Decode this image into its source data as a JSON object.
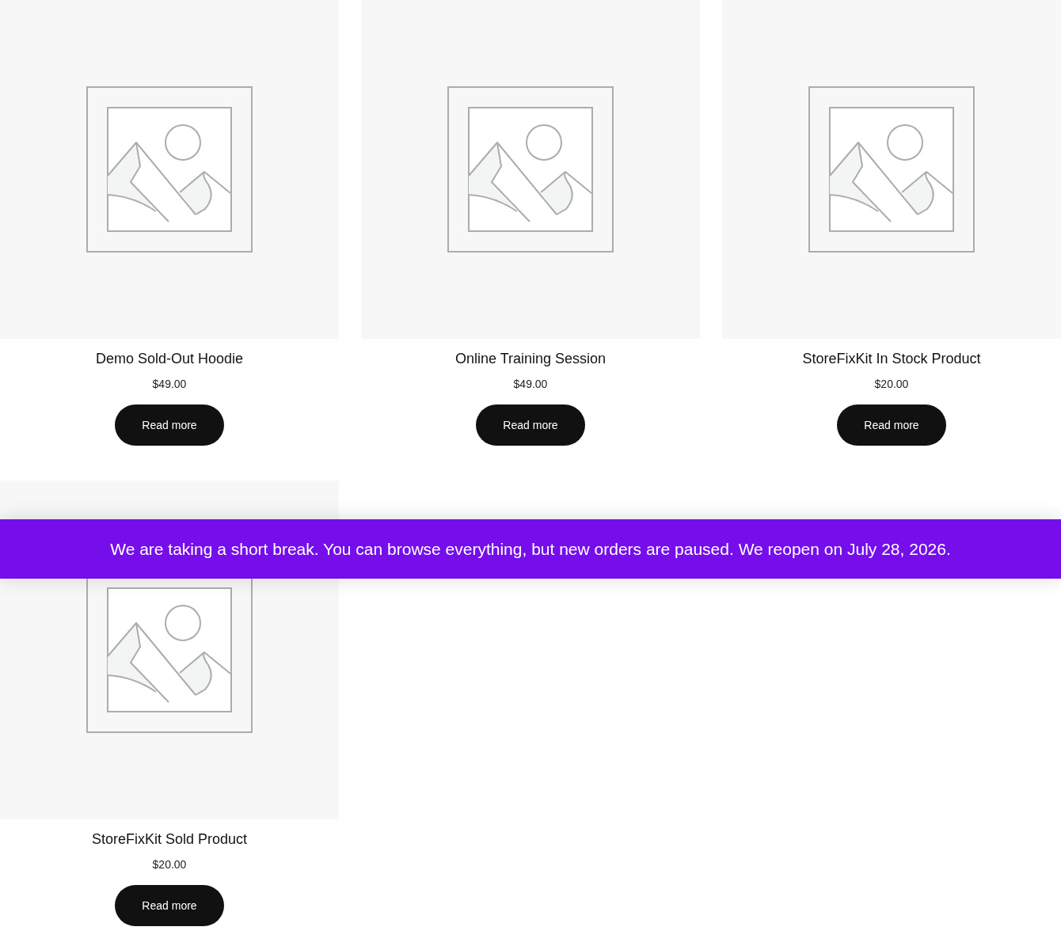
{
  "products": [
    {
      "title": "Demo Sold-Out Hoodie",
      "price": "$49.00",
      "button": "Read more"
    },
    {
      "title": "Online Training Session",
      "price": "$49.00",
      "button": "Read more"
    },
    {
      "title": "StoreFixKit In Stock Product",
      "price": "$20.00",
      "button": "Read more"
    },
    {
      "title": "StoreFixKit Sold Product",
      "price": "$20.00",
      "button": "Read more"
    }
  ],
  "notice": {
    "text": "We are taking a short break. You can browse everything, but new orders are paused. We reopen on July 28, 2026."
  }
}
